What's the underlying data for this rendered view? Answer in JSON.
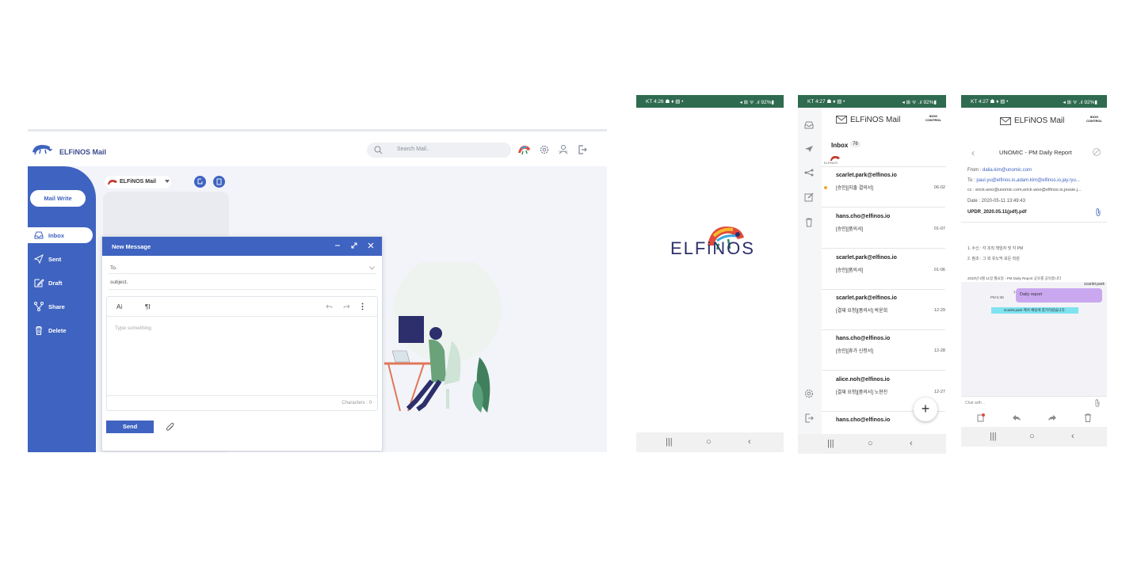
{
  "desktop": {
    "app_title": "ELFiNOS Mail",
    "search_placeholder": "Search Mail..",
    "account_label": "ELFiNOS Mail",
    "sidebar": {
      "write_button": "Mail Write",
      "items": [
        {
          "label": "Inbox",
          "icon": "inbox-icon"
        },
        {
          "label": "Sent",
          "icon": "send-icon"
        },
        {
          "label": "Draft",
          "icon": "edit-icon"
        },
        {
          "label": "Share",
          "icon": "share-icon"
        },
        {
          "label": "Delete",
          "icon": "trash-icon"
        }
      ]
    },
    "compose": {
      "title": "New Message",
      "to_label": "To.",
      "subject_label": "subject.",
      "font_button": "Ai",
      "paragraph_button": "¶I",
      "body_placeholder": "Type something",
      "char_counter": "Characters : 0",
      "send_button": "Send"
    }
  },
  "splash": {
    "status_left": "KT 4:26 ☗ ♦ ▧ •",
    "status_right": "◂ ⊞ ᯤ .ıl 92%▮",
    "logo_text": "ELFiNOS"
  },
  "inbox_phone": {
    "status_left": "KT 4:27 ☗ ♦ ▧ •",
    "status_right": "◂ ⊞ ᯤ .ıl 92%▮",
    "app_title": "ELFiNOS Mail",
    "logo_small_text": "ELFiNOS",
    "badge_text": "IDOO CONTROL",
    "inbox_label": "Inbox",
    "inbox_count": "76",
    "mails": [
      {
        "from": "scarlet.park@elfinos.io",
        "subject": "[승인][지출 결의서]",
        "date": "06-02",
        "unread": true
      },
      {
        "from": "hans.cho@elfinos.io",
        "subject": "[승인][품의서]",
        "date": "01-07",
        "unread": false
      },
      {
        "from": "scarlet.park@elfinos.io",
        "subject": "[승인][품의서]",
        "date": "01-06",
        "unread": false
      },
      {
        "from": "scarlet.park@elfinos.io",
        "subject": "[결재 요청][품의서] 박윤희",
        "date": "12-29",
        "unread": false
      },
      {
        "from": "hans.cho@elfinos.io",
        "subject": "[승인][휴가 신청서]",
        "date": "12-28",
        "unread": false
      },
      {
        "from": "alice.noh@elfinos.io",
        "subject": "[결재 요청][품의서] 노현진",
        "date": "12-27",
        "unread": false
      },
      {
        "from": "hans.cho@elfinos.io",
        "subject": "",
        "date": "",
        "unread": false
      }
    ],
    "fab_label": "+"
  },
  "detail_phone": {
    "status_left": "KT 4:27 ☗ ♦ ▧ •",
    "status_right": "◂ ⊞ ᯤ .ıl 92%▮",
    "app_title": "ELFiNOS Mail",
    "badge_text": "IDOO CONTROL",
    "mail_title": "UNOMIC - PM Daily Report",
    "from_label": "From :",
    "from_value": "dalia.kim@unomic.com",
    "to_label": "To :",
    "to_value": "paul.yu@elfinos.io,adam.kim@elfinos.io,jay.ryu...",
    "cc_line": "cc : erick.woo@unomic.com,erick.woo@elfinos.io,jessie.j...",
    "date_line": "Date : 2020-05-11 13:49:43",
    "attachment": "UPDR_2020.05.11(pdf).pdf",
    "body_line1": "1. 수신 : 각 조직 책임자 및 각 PM",
    "body_line2": "2. 참조 : 그 외 유노믹 모든 직원",
    "body_line3": "2020년 5월 11일 월요일 - PM Daily Report 공유를 공유합니다",
    "chat_user": "scarlet.park",
    "chat_time": "PM 5:38",
    "chat_bubble": "Daily report",
    "chat_system": "scarlet.park 께서 채팅에 참가하셨습니다.",
    "chat_placeholder": "Chat with ..",
    "chat_side_num": "1"
  },
  "colors": {
    "primary": "#3f63c0",
    "status_bar": "#2f6b4e",
    "chat_bubble": "#c9a8f0",
    "system_msg": "#7fe3f0"
  }
}
